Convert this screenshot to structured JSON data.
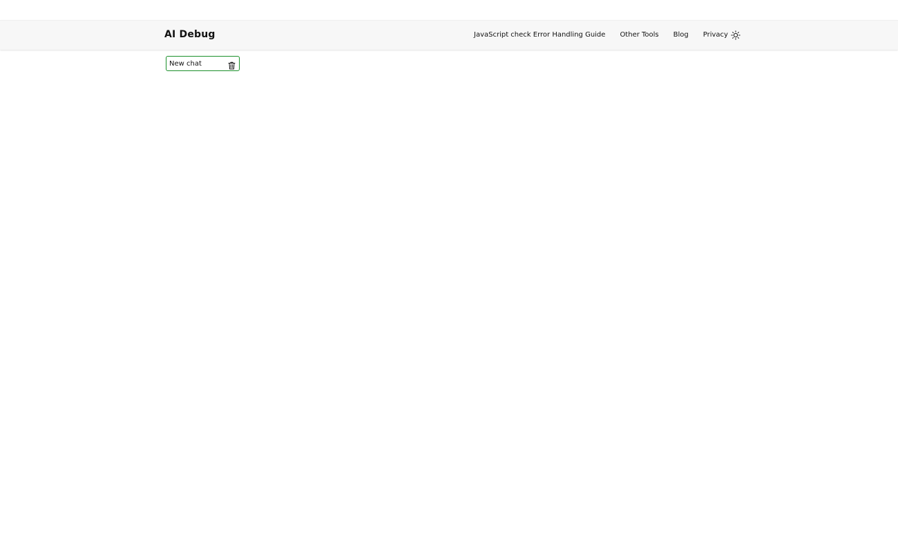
{
  "header": {
    "brand": "AI Debug",
    "nav": [
      {
        "label": "JavaScript check Error Handling Guide"
      },
      {
        "label": "Other Tools"
      },
      {
        "label": "Blog"
      },
      {
        "label": "Privacy"
      }
    ],
    "theme_icon": "sun-icon"
  },
  "sidebar": {
    "chats": [
      {
        "label": "New chat",
        "delete_icon": "trash-icon"
      }
    ]
  },
  "colors": {
    "active_border": "#1a8f2a",
    "header_bg": "#f7f7f7"
  }
}
